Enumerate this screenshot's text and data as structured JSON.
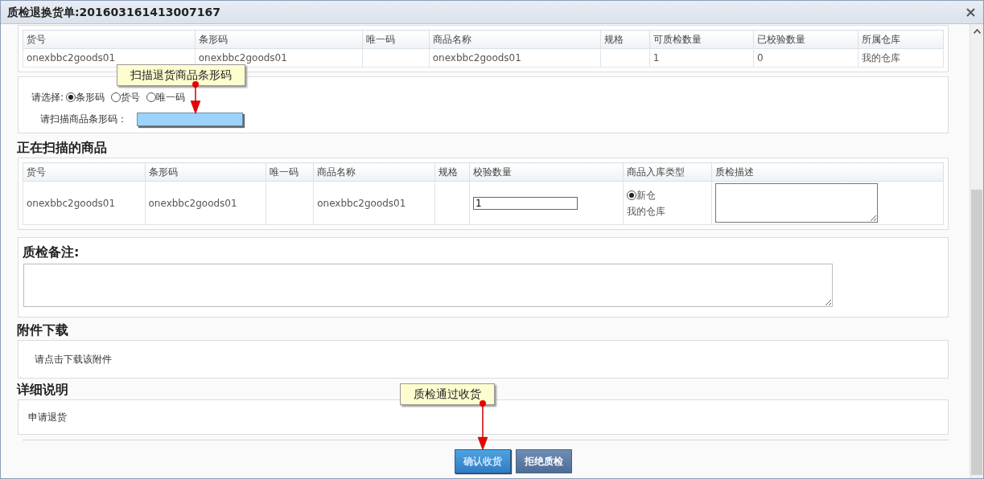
{
  "window": {
    "title": "质检退换货单:201603161413007167"
  },
  "order_table": {
    "columns": [
      "货号",
      "条形码",
      "唯一码",
      "商品名称",
      "规格",
      "可质检数量",
      "已校验数量",
      "所属仓库"
    ],
    "rows": [
      [
        "onexbbc2goods01",
        "onexbbc2goods01",
        "",
        "onexbbc2goods01",
        "",
        "1",
        "0",
        "我的仓库"
      ]
    ]
  },
  "scan": {
    "prompt": "请选择:",
    "options": [
      {
        "label": "条形码",
        "selected": true
      },
      {
        "label": "货号",
        "selected": false
      },
      {
        "label": "唯一码",
        "selected": false
      }
    ],
    "field_label": "请扫描商品条形码："
  },
  "scanning": {
    "heading": "正在扫描的商品",
    "columns": [
      "货号",
      "条形码",
      "唯一码",
      "商品名称",
      "规格",
      "校验数量",
      "商品入库类型",
      "质检描述"
    ],
    "rows": [
      {
        "item_no": "onexbbc2goods01",
        "barcode": "onexbbc2goods01",
        "unique_code": "",
        "name": "onexbbc2goods01",
        "spec": "",
        "check_qty": "1",
        "stock_types": [
          {
            "label": "新仓",
            "selected": true
          }
        ],
        "warehouse": "我的仓库"
      }
    ]
  },
  "remarks": {
    "heading": "质检备注:"
  },
  "attachments": {
    "heading": "附件下载",
    "text": "请点击下载该附件"
  },
  "details": {
    "heading": "详细说明",
    "text": "申请退货"
  },
  "buttons": [
    {
      "label": "确认收货",
      "kind": "primary"
    },
    {
      "label": "拒绝质检",
      "kind": "secondary"
    }
  ],
  "callouts": [
    {
      "text": "扫描退货商品条形码"
    },
    {
      "text": "质检通过收货"
    }
  ]
}
